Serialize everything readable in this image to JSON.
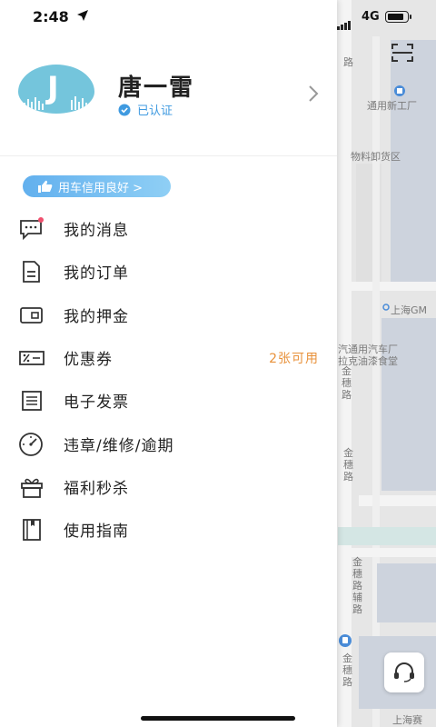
{
  "status_bar": {
    "time": "2:48",
    "network": "4G",
    "battery_level": 0.85
  },
  "profile": {
    "avatar_letter": "J",
    "name": "唐一雷",
    "verified_text": "已认证"
  },
  "credit_badge": {
    "label": "用车信用良好 >"
  },
  "menu": [
    {
      "label": "我的消息",
      "icon": "message-icon",
      "has_dot": true
    },
    {
      "label": "我的订单",
      "icon": "order-icon"
    },
    {
      "label": "我的押金",
      "icon": "wallet-icon"
    },
    {
      "label": "优惠券",
      "icon": "coupon-icon",
      "extra": "2张可用"
    },
    {
      "label": "电子发票",
      "icon": "invoice-icon"
    },
    {
      "label": "违章/维修/逾期",
      "icon": "gauge-icon"
    },
    {
      "label": "福利秒杀",
      "icon": "gift-icon"
    },
    {
      "label": "使用指南",
      "icon": "guide-book-icon"
    }
  ],
  "map": {
    "labels": {
      "road_top": "路",
      "poi_1": "通用新工厂",
      "poi_2": "物料卸货区",
      "poi_3": "上海GM",
      "poi_4": "汽通用汽车厂",
      "poi_5": "拉克油漆食堂",
      "road_1": "金穗路",
      "road_2": "金穗路",
      "road_3": "金穗路辅路",
      "road_4": "金穗路",
      "bottom": "上海赛"
    }
  },
  "colors": {
    "accent": "#3f9ae0",
    "badge": "#62b0ee",
    "coupon": "#e8913a"
  }
}
